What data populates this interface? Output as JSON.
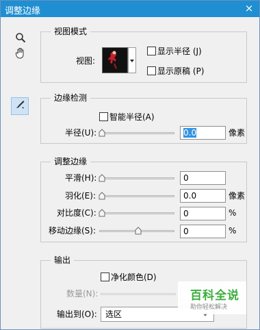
{
  "window": {
    "title": "调整边缘",
    "close_glyph": "×"
  },
  "tools": [
    {
      "name": "zoom-tool",
      "icon": "magnifier-icon"
    },
    {
      "name": "hand-tool",
      "icon": "hand-icon"
    },
    {
      "name": "refine-radius-tool",
      "icon": "brush-icon"
    }
  ],
  "view_mode": {
    "legend": "视图模式",
    "view_label": "视图:",
    "show_radius": {
      "label": "显示半径 (J)",
      "checked": false
    },
    "show_original": {
      "label": "显示原稿 (P)",
      "checked": false
    }
  },
  "edge_detection": {
    "legend": "边缘检测",
    "smart_radius": {
      "label": "智能半径(A)",
      "checked": false
    },
    "radius": {
      "label": "半径(U):",
      "value": "0.0",
      "unit": "像素",
      "slider": 0
    }
  },
  "adjust_edge": {
    "legend": "调整边缘",
    "smooth": {
      "label": "平滑(H):",
      "value": "0",
      "slider": 0
    },
    "feather": {
      "label": "羽化(E):",
      "value": "0.0",
      "unit": "像素",
      "slider": 0
    },
    "contrast": {
      "label": "对比度(C):",
      "value": "0",
      "unit": "%",
      "slider": 0
    },
    "shift_edge": {
      "label": "移动边缘(S):",
      "value": "0",
      "unit": "%",
      "slider": 0.5
    }
  },
  "output": {
    "legend": "输出",
    "decontaminate": {
      "label": "净化颜色(D)",
      "checked": false
    },
    "amount": {
      "label": "数量(N):",
      "value": "",
      "slider": 1,
      "disabled": true
    },
    "output_to": {
      "label": "输出到(O):",
      "selected": "选区"
    }
  },
  "watermark": {
    "title": "百科全说",
    "subtitle": "助你轻松解决"
  },
  "colors": {
    "titlebar": "#1f8fd1",
    "panel": "#f0f0f0",
    "selection": "#3393df"
  }
}
